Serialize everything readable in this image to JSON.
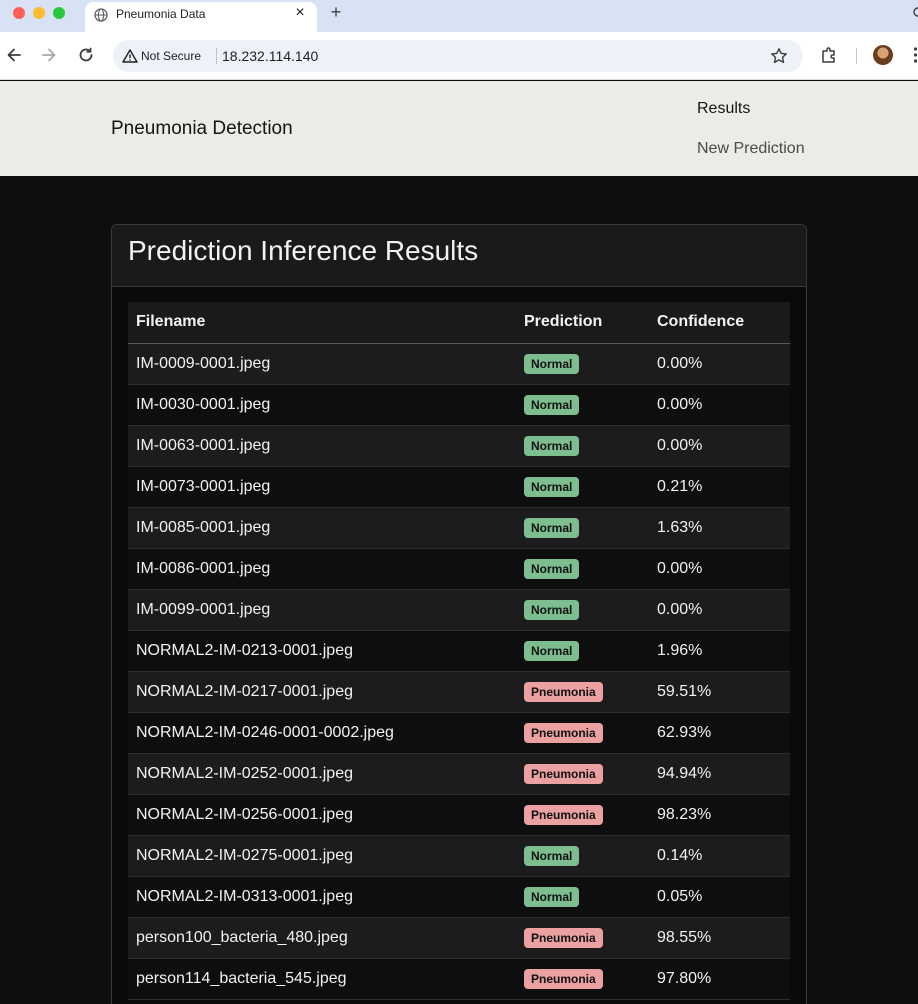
{
  "browser": {
    "tab_title": "Pneumonia Data",
    "close_symbol": "×",
    "new_tab_symbol": "+",
    "security_label": "Not Secure",
    "url": "18.232.114.140",
    "icons": [
      "globe-icon",
      "close-icon",
      "plus-icon",
      "back-arrow-icon",
      "forward-arrow-icon",
      "reload-icon",
      "warning-icon",
      "star-icon",
      "extensions-icon",
      "avatar",
      "menu-dots-icon"
    ]
  },
  "site": {
    "brand": "Pneumonia Detection",
    "nav": {
      "results": "Results",
      "new_prediction": "New Prediction"
    }
  },
  "card": {
    "title": "Prediction Inference Results"
  },
  "table": {
    "headers": {
      "filename": "Filename",
      "prediction": "Prediction",
      "confidence": "Confidence"
    },
    "rows": [
      {
        "filename": "IM-0009-0001.jpeg",
        "prediction": "Normal",
        "confidence": "0.00%"
      },
      {
        "filename": "IM-0030-0001.jpeg",
        "prediction": "Normal",
        "confidence": "0.00%"
      },
      {
        "filename": "IM-0063-0001.jpeg",
        "prediction": "Normal",
        "confidence": "0.00%"
      },
      {
        "filename": "IM-0073-0001.jpeg",
        "prediction": "Normal",
        "confidence": "0.21%"
      },
      {
        "filename": "IM-0085-0001.jpeg",
        "prediction": "Normal",
        "confidence": "1.63%"
      },
      {
        "filename": "IM-0086-0001.jpeg",
        "prediction": "Normal",
        "confidence": "0.00%"
      },
      {
        "filename": "IM-0099-0001.jpeg",
        "prediction": "Normal",
        "confidence": "0.00%"
      },
      {
        "filename": "NORMAL2-IM-0213-0001.jpeg",
        "prediction": "Normal",
        "confidence": "1.96%"
      },
      {
        "filename": "NORMAL2-IM-0217-0001.jpeg",
        "prediction": "Pneumonia",
        "confidence": "59.51%"
      },
      {
        "filename": "NORMAL2-IM-0246-0001-0002.jpeg",
        "prediction": "Pneumonia",
        "confidence": "62.93%"
      },
      {
        "filename": "NORMAL2-IM-0252-0001.jpeg",
        "prediction": "Pneumonia",
        "confidence": "94.94%"
      },
      {
        "filename": "NORMAL2-IM-0256-0001.jpeg",
        "prediction": "Pneumonia",
        "confidence": "98.23%"
      },
      {
        "filename": "NORMAL2-IM-0275-0001.jpeg",
        "prediction": "Normal",
        "confidence": "0.14%"
      },
      {
        "filename": "NORMAL2-IM-0313-0001.jpeg",
        "prediction": "Normal",
        "confidence": "0.05%"
      },
      {
        "filename": "person100_bacteria_480.jpeg",
        "prediction": "Pneumonia",
        "confidence": "98.55%"
      },
      {
        "filename": "person114_bacteria_545.jpeg",
        "prediction": "Pneumonia",
        "confidence": "97.80%"
      }
    ]
  },
  "colors": {
    "normal_badge": "#7dbd8f",
    "pneumonia_badge": "#eba0a2",
    "page_background": "#0e0e0e",
    "navbar_background": "#ecebe6"
  }
}
